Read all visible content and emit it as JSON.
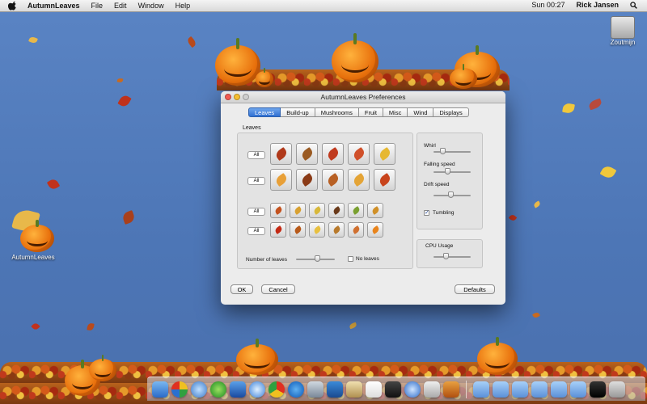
{
  "menubar": {
    "app_name": "AutumnLeaves",
    "items": [
      "File",
      "Edit",
      "Window",
      "Help"
    ],
    "clock": "Sun 00:27",
    "user": "Rick Jansen"
  },
  "desktop": {
    "drive_label": "Zoutmijn",
    "app_icon_label": "AutumnLeaves"
  },
  "window": {
    "title": "AutumnLeaves Preferences",
    "tabs": [
      {
        "label": "Leaves",
        "active": true
      },
      {
        "label": "Build-up",
        "active": false
      },
      {
        "label": "Mushrooms",
        "active": false
      },
      {
        "label": "Fruit",
        "active": false
      },
      {
        "label": "Misc",
        "active": false
      },
      {
        "label": "Wind",
        "active": false
      },
      {
        "label": "Displays",
        "active": false
      }
    ],
    "leaves_group_label": "Leaves",
    "all_label": "All",
    "number_of_leaves_label": "Number of leaves",
    "number_of_leaves_value": 0.55,
    "no_leaves_label": "No leaves",
    "no_leaves_checked": false,
    "whirl_label": "Whirl",
    "whirl_value": 0.2,
    "falling_speed_label": "Falling speed",
    "falling_speed_value": 0.35,
    "drift_speed_label": "Drift speed",
    "drift_speed_value": 0.45,
    "tumbling_label": "Tumbling",
    "tumbling_checked": true,
    "cpu_usage_label": "CPU Usage",
    "cpu_usage_value": 0.3,
    "ok_label": "OK",
    "cancel_label": "Cancel",
    "defaults_label": "Defaults",
    "leaf_colors_row1": [
      "#b0391a",
      "#9a5a22",
      "#c03a1e",
      "#d0502a",
      "#e6b832"
    ],
    "leaf_colors_row2": [
      "#e8a038",
      "#8a3a16",
      "#b86024",
      "#e4a436",
      "#c8441c"
    ],
    "leaf_colors_row3": [
      "#c4521e",
      "#d8a030",
      "#d8b83a",
      "#6a3a1a",
      "#7aa030",
      "#d09028"
    ],
    "leaf_colors_row4": [
      "#c42a14",
      "#b85a1a",
      "#e8c040",
      "#b87a2c",
      "#d07030",
      "#e8841c"
    ]
  }
}
